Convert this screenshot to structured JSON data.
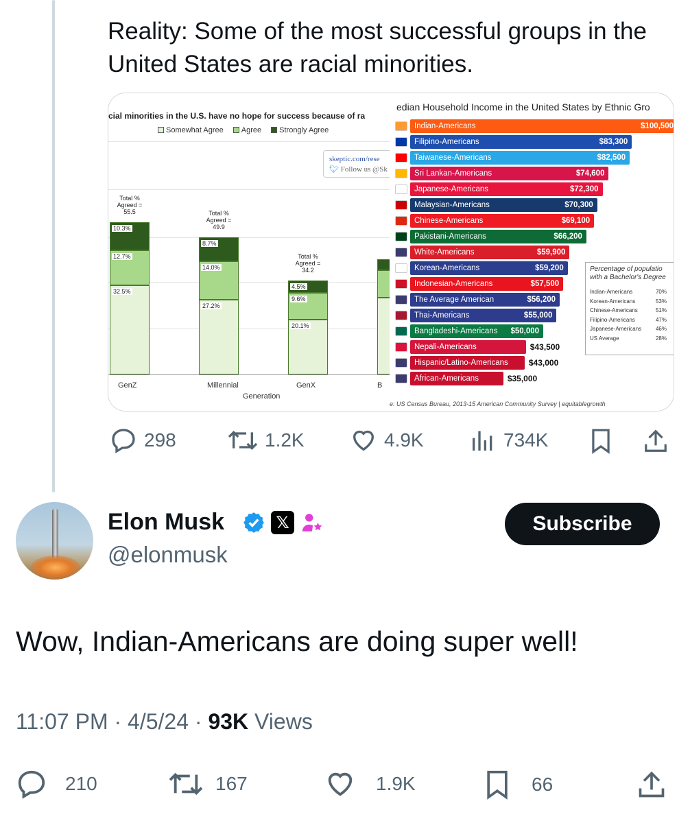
{
  "quoted_post": {
    "text": "Reality: Some of the most successful groups in the United States are racial minorities.",
    "stats": {
      "replies": "298",
      "reposts": "1.2K",
      "likes": "4.9K",
      "views": "734K"
    }
  },
  "media": {
    "left_chart": {
      "title": "cial minorities in the U.S. have no hope for success because of ra",
      "legend": [
        "Somewhat Agree",
        "Agree",
        "Strongly Agree"
      ],
      "watermark": {
        "site": "skeptic.com/rese",
        "follow": "Follow us @Sk"
      },
      "xlabel": "Generation",
      "total_prefix": "Total %",
      "total_mid": "Agreed =",
      "groups": [
        {
          "name": "GenZ",
          "total": "55.5",
          "somewhat": "32.5%",
          "agree": "12.7%",
          "strong": "10.3%"
        },
        {
          "name": "Millennial",
          "total": "49.9",
          "somewhat": "27.2%",
          "agree": "14.0%",
          "strong": "8.7%"
        },
        {
          "name": "GenX",
          "total": "34.2",
          "somewhat": "20.1%",
          "agree": "9.6%",
          "strong": "4.5%"
        },
        {
          "name": "B",
          "total": "",
          "somewhat": "",
          "agree": "",
          "strong": ""
        }
      ]
    },
    "right_chart": {
      "title": "edian Household Income in the United States  by Ethnic Gro",
      "source": "e: US Census Bureau, 2013-15 American Community Survey | equitablegrowth",
      "bachelor_box": {
        "title_line1": "Percentage of populatio",
        "title_line2": "with a Bachelor's Degree",
        "rows": [
          {
            "group": "Indian-Americans",
            "pct": "70%"
          },
          {
            "group": "Korean-Americans",
            "pct": "53%"
          },
          {
            "group": "Chinese-Americans",
            "pct": "51%"
          },
          {
            "group": "Filipino-Americans",
            "pct": "47%"
          },
          {
            "group": "Japanese-Americans",
            "pct": "46%"
          },
          {
            "group": "US Average",
            "pct": "28%"
          }
        ]
      }
    }
  },
  "chart_data": [
    {
      "type": "bar",
      "title": "cial minorities in the U.S. have no hope for success because of ra",
      "xlabel": "Generation",
      "categories": [
        "GenZ",
        "Millennial",
        "GenX"
      ],
      "series": [
        {
          "name": "Somewhat Agree",
          "values": [
            32.5,
            27.2,
            20.1
          ]
        },
        {
          "name": "Agree",
          "values": [
            12.7,
            14.0,
            9.6
          ]
        },
        {
          "name": "Strongly Agree",
          "values": [
            10.3,
            8.7,
            4.5
          ]
        }
      ],
      "totals": [
        55.5,
        49.9,
        34.2
      ],
      "colors": {
        "Somewhat Agree": "#e6f3d8",
        "Agree": "#a8d88a",
        "Strongly Agree": "#2f5a1e"
      }
    },
    {
      "type": "bar",
      "orientation": "horizontal",
      "title": "edian Household Income in the United States  by Ethnic Gro",
      "categories": [
        "Indian-Americans",
        "Filipino-Americans",
        "Taiwanese-Americans",
        "Sri Lankan-Americans",
        "Japanese-Americans",
        "Malaysian-Americans",
        "Chinese-Americans",
        "Pakistani-Americans",
        "White-Americans",
        "Korean-Americans",
        "Indonesian-Americans",
        "The Average American",
        "Thai-Americans",
        "Bangladeshi-Americans",
        "Nepali-Americans",
        "Hispanic/Latino-Americans",
        "African-Americans"
      ],
      "values": [
        100500,
        83300,
        82500,
        74600,
        72300,
        70300,
        69100,
        66200,
        59900,
        59200,
        57500,
        56200,
        55000,
        50000,
        43500,
        43000,
        35000
      ],
      "labels": [
        "$100,500",
        "$83,300",
        "$82,500",
        "$74,600",
        "$72,300",
        "$70,300",
        "$69,100",
        "$66,200",
        "$59,900",
        "$59,200",
        "$57,500",
        "$56,200",
        "$55,000",
        "$50,000",
        "$43,500",
        "$43,000",
        "$35,000"
      ],
      "colors": [
        "#fd5b12",
        "#1f4fae",
        "#2aa7e6",
        "#d8154b",
        "#e8153e",
        "#163a6e",
        "#ef1c24",
        "#0e6b35",
        "#d81f2a",
        "#2c3f8e",
        "#e8151f",
        "#2d3c8c",
        "#2d3c8c",
        "#0b7a43",
        "#d4163c",
        "#c8102e",
        "#c8102e"
      ]
    }
  ],
  "author": {
    "name": "Elon Musk",
    "handle": "@elonmusk",
    "verified_icon": "verified-badge-icon",
    "x_badge": "𝕏",
    "subscribe_label": "Subscribe"
  },
  "post": {
    "text": "Wow, Indian-Americans are doing super well!",
    "time": "11:07 PM · 4/5/24 · ",
    "views_count": "93K",
    "views_label": " Views",
    "stats": {
      "replies": "210",
      "reposts": "167",
      "likes": "1.9K",
      "bookmarks": "66"
    }
  }
}
